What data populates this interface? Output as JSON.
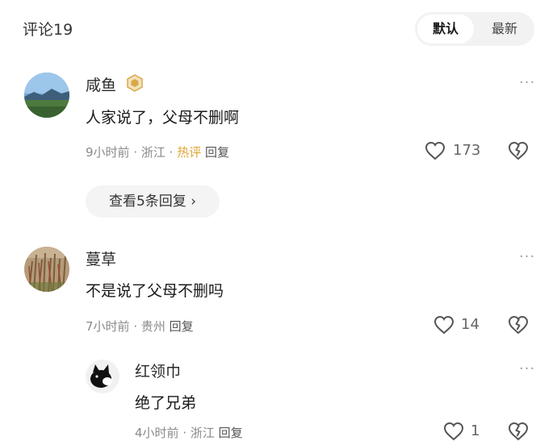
{
  "header": {
    "title": "评论19"
  },
  "sort": {
    "default_label": "默认",
    "latest_label": "最新"
  },
  "comments": [
    {
      "username": "咸鱼",
      "content": "人家说了，父母不删啊",
      "time": "9小时前",
      "location": "浙江",
      "hot_label": "热评",
      "reply_label": "回复",
      "likes": "173",
      "more_label": "···"
    },
    {
      "username": "蔓草",
      "content": "不是说了父母不删吗",
      "time": "7小时前",
      "location": "贵州",
      "reply_label": "回复",
      "likes": "14",
      "more_label": "···"
    }
  ],
  "thread": {
    "view_replies_label": "查看5条回复 ›"
  },
  "replies": [
    {
      "username": "红领巾",
      "content": "绝了兄弟",
      "time": "4小时前",
      "location": "浙江",
      "reply_label": "回复",
      "likes": "1",
      "more_label": "···"
    }
  ],
  "colors": {
    "hot": "#e0a533",
    "badge": "#d9a84a",
    "meta": "#8a8a8a"
  },
  "icons": [
    "badge-icon",
    "heart-icon",
    "dislike-heart-icon",
    "more-icon"
  ]
}
